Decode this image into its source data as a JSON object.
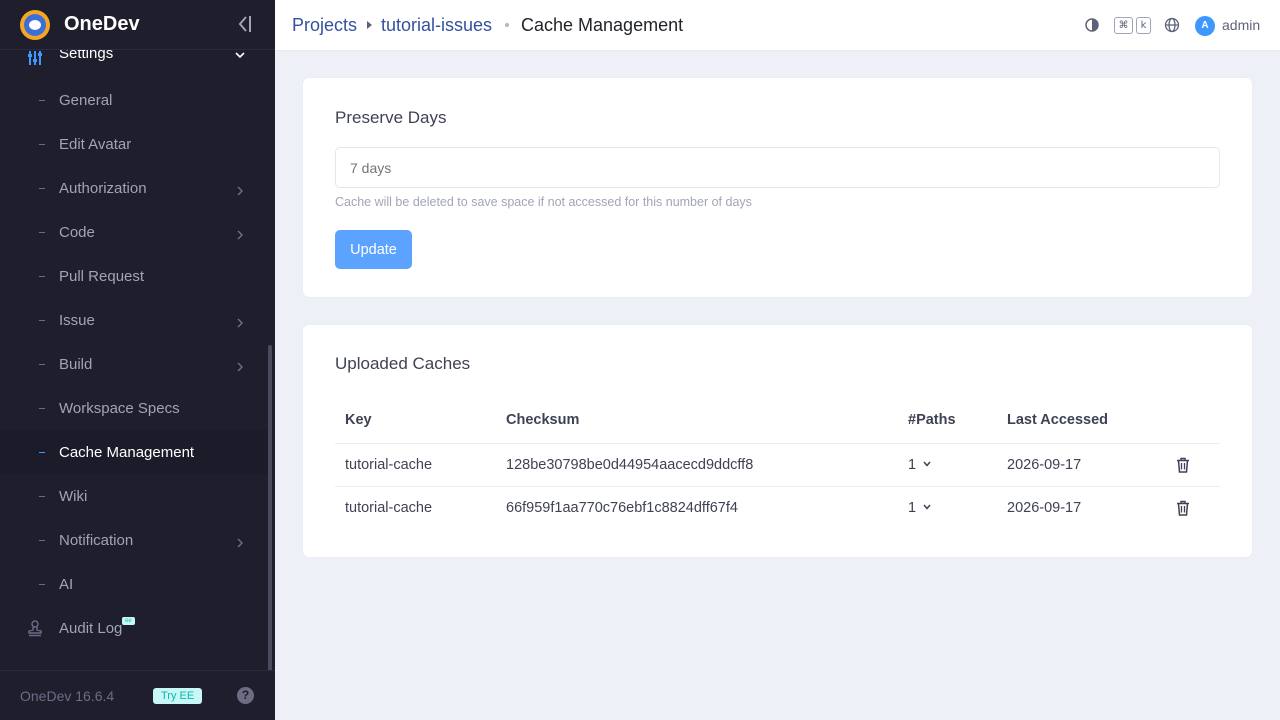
{
  "app": {
    "name": "OneDev",
    "version": "OneDev 16.6.4",
    "try_ee": "Try EE",
    "help": "?"
  },
  "sidebar": {
    "section": "Settings",
    "items": [
      {
        "label": "General",
        "has_children": false
      },
      {
        "label": "Edit Avatar",
        "has_children": false
      },
      {
        "label": "Authorization",
        "has_children": true
      },
      {
        "label": "Code",
        "has_children": true
      },
      {
        "label": "Pull Request",
        "has_children": false
      },
      {
        "label": "Issue",
        "has_children": true
      },
      {
        "label": "Build",
        "has_children": true
      },
      {
        "label": "Workspace Specs",
        "has_children": false
      },
      {
        "label": "Cache Management",
        "has_children": false,
        "active": true
      },
      {
        "label": "Wiki",
        "has_children": false
      },
      {
        "label": "Notification",
        "has_children": true
      },
      {
        "label": "AI",
        "has_children": false
      }
    ],
    "audit_log": "Audit Log",
    "audit_badge": "ee"
  },
  "breadcrumb": {
    "projects": "Projects",
    "project": "tutorial-issues",
    "page": "Cache Management"
  },
  "topbar": {
    "kbd_cmd": "⌘",
    "kbd_k": "k",
    "avatar_letter": "A",
    "user": "admin"
  },
  "preserve": {
    "title": "Preserve Days",
    "placeholder": "7 days",
    "help": "Cache will be deleted to save space if not accessed for this number of days",
    "button": "Update"
  },
  "caches": {
    "title": "Uploaded Caches",
    "columns": [
      "Key",
      "Checksum",
      "#Paths",
      "Last Accessed"
    ],
    "rows": [
      {
        "key": "tutorial-cache",
        "checksum": "128be30798be0d44954aacecd9ddcff8",
        "paths": "1",
        "last_accessed": "2026-09-17"
      },
      {
        "key": "tutorial-cache",
        "checksum": "66f959f1aa770c76ebf1c8824dff67f4",
        "paths": "1",
        "last_accessed": "2026-09-17"
      }
    ]
  },
  "colors": {
    "sidebar_bg": "#1e1e2d",
    "accent": "#3e97ff",
    "button": "#5ca3ff",
    "link": "#3451a1",
    "page_bg": "#eef0f8"
  }
}
